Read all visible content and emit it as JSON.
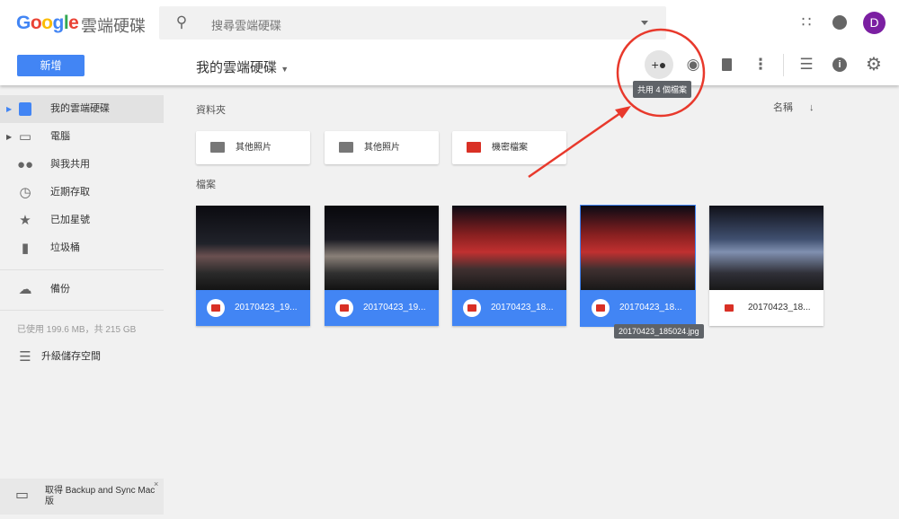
{
  "header": {
    "logo": "Google",
    "product": "雲端硬碟",
    "search_placeholder": "搜尋雲端硬碟",
    "avatar": "D"
  },
  "toolbar": {
    "new_label": "新增",
    "breadcrumb": "我的雲端硬碟",
    "share_tooltip": "共用 4 個檔案"
  },
  "sidebar": {
    "items": [
      {
        "label": "我的雲端硬碟",
        "icon": "drive-icon"
      },
      {
        "label": "電腦",
        "icon": "computer-icon"
      },
      {
        "label": "與我共用",
        "icon": "people-icon"
      },
      {
        "label": "近期存取",
        "icon": "clock-icon"
      },
      {
        "label": "已加星號",
        "icon": "star-icon"
      },
      {
        "label": "垃圾桶",
        "icon": "trash-icon"
      }
    ],
    "backup": "備份",
    "storage": "已使用 199.6 MB，共 215 GB",
    "upgrade": "升級儲存空間",
    "promo": "取得 Backup and Sync Mac 版"
  },
  "main": {
    "folders_heading": "資料夾",
    "sort_label": "名稱",
    "files_heading": "檔案",
    "folders": [
      "其他照片",
      "其他照片",
      "機密檔案"
    ],
    "files": [
      {
        "name": "20170423_19...",
        "selected": true
      },
      {
        "name": "20170423_19...",
        "selected": true
      },
      {
        "name": "20170423_18...",
        "selected": true
      },
      {
        "name": "20170423_18...",
        "selected": true
      },
      {
        "name": "20170423_18...",
        "selected": false
      }
    ],
    "file_tooltip": "20170423_185024.jpg"
  },
  "colors": {
    "accent": "#4285f4",
    "annotation": "#e8392c"
  }
}
